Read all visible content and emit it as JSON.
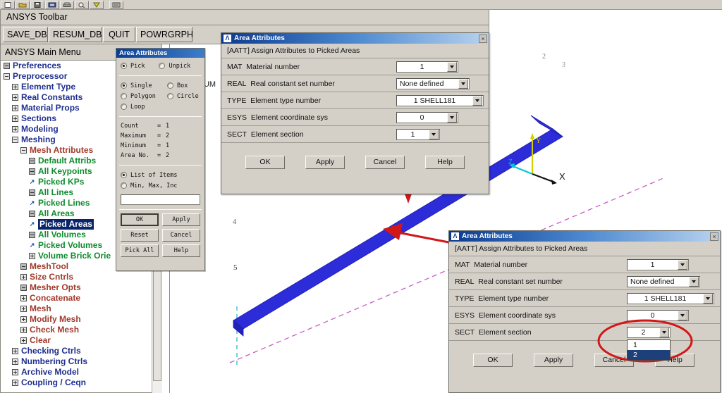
{
  "icon_toolbar": {
    "icons": [
      "new-file-icon",
      "open-folder-icon",
      "save-disk-icon",
      "read-input-icon",
      "print-icon",
      "print-preview-icon",
      "report-icon",
      "ansys-help-icon"
    ]
  },
  "toolbar": {
    "label": "ANSYS Toolbar",
    "buttons": [
      "SAVE_DB",
      "RESUM_DB",
      "QUIT",
      "POWRGRPH"
    ]
  },
  "main_menu": {
    "header": "ANSYS Main Menu",
    "items": [
      {
        "label": "Preferences",
        "indent": 0,
        "icon": "box-solid",
        "color": "blue",
        "selected": false
      },
      {
        "label": "Preprocessor",
        "indent": 0,
        "icon": "box-minus",
        "color": "blue",
        "selected": false
      },
      {
        "label": "Element Type",
        "indent": 1,
        "icon": "box-plus",
        "color": "blue",
        "selected": false
      },
      {
        "label": "Real Constants",
        "indent": 1,
        "icon": "box-plus",
        "color": "blue",
        "selected": false
      },
      {
        "label": "Material Props",
        "indent": 1,
        "icon": "box-plus",
        "color": "blue",
        "selected": false
      },
      {
        "label": "Sections",
        "indent": 1,
        "icon": "box-plus",
        "color": "blue",
        "selected": false
      },
      {
        "label": "Modeling",
        "indent": 1,
        "icon": "box-plus",
        "color": "blue",
        "selected": false
      },
      {
        "label": "Meshing",
        "indent": 1,
        "icon": "box-minus",
        "color": "blue",
        "selected": false
      },
      {
        "label": "Mesh Attributes",
        "indent": 2,
        "icon": "box-minus",
        "color": "red",
        "selected": false
      },
      {
        "label": "Default Attribs",
        "indent": 3,
        "icon": "box-solid",
        "color": "green",
        "selected": false
      },
      {
        "label": "All Keypoints",
        "indent": 3,
        "icon": "box-solid",
        "color": "green",
        "selected": false
      },
      {
        "label": "Picked KPs",
        "indent": 3,
        "icon": "arrow",
        "color": "green",
        "selected": false
      },
      {
        "label": "All Lines",
        "indent": 3,
        "icon": "box-solid",
        "color": "green",
        "selected": false
      },
      {
        "label": "Picked Lines",
        "indent": 3,
        "icon": "arrow",
        "color": "green",
        "selected": false
      },
      {
        "label": "All Areas",
        "indent": 3,
        "icon": "box-solid",
        "color": "green",
        "selected": false
      },
      {
        "label": "Picked Areas",
        "indent": 3,
        "icon": "arrow",
        "color": "green",
        "selected": true
      },
      {
        "label": "All Volumes",
        "indent": 3,
        "icon": "box-solid",
        "color": "green",
        "selected": false
      },
      {
        "label": "Picked Volumes",
        "indent": 3,
        "icon": "arrow",
        "color": "green",
        "selected": false
      },
      {
        "label": "Volume Brick Orie",
        "indent": 3,
        "icon": "box-plus",
        "color": "green",
        "selected": false
      },
      {
        "label": "MeshTool",
        "indent": 2,
        "icon": "box-solid",
        "color": "red",
        "selected": false
      },
      {
        "label": "Size Cntrls",
        "indent": 2,
        "icon": "box-plus",
        "color": "red",
        "selected": false
      },
      {
        "label": "Mesher Opts",
        "indent": 2,
        "icon": "box-solid",
        "color": "red",
        "selected": false
      },
      {
        "label": "Concatenate",
        "indent": 2,
        "icon": "box-plus",
        "color": "red",
        "selected": false
      },
      {
        "label": "Mesh",
        "indent": 2,
        "icon": "box-plus",
        "color": "red",
        "selected": false
      },
      {
        "label": "Modify Mesh",
        "indent": 2,
        "icon": "box-plus",
        "color": "red",
        "selected": false
      },
      {
        "label": "Check Mesh",
        "indent": 2,
        "icon": "box-plus",
        "color": "red",
        "selected": false
      },
      {
        "label": "Clear",
        "indent": 2,
        "icon": "box-plus",
        "color": "red",
        "selected": false
      },
      {
        "label": "Checking Ctrls",
        "indent": 1,
        "icon": "box-plus",
        "color": "blue",
        "selected": false
      },
      {
        "label": "Numbering Ctrls",
        "indent": 1,
        "icon": "box-plus",
        "color": "blue",
        "selected": false
      },
      {
        "label": "Archive Model",
        "indent": 1,
        "icon": "box-plus",
        "color": "blue",
        "selected": false
      },
      {
        "label": "Coupling / Ceqn",
        "indent": 1,
        "icon": "box-plus",
        "color": "blue",
        "selected": false
      }
    ]
  },
  "pick_dialog": {
    "title": "Area Attributes",
    "mode_options": [
      {
        "label": "Pick",
        "selected": true
      },
      {
        "label": "Unpick",
        "selected": false
      }
    ],
    "shape_options": [
      {
        "label": "Single",
        "selected": true
      },
      {
        "label": "Box",
        "selected": false
      },
      {
        "label": "Polygon",
        "selected": false
      },
      {
        "label": "Circle",
        "selected": false
      },
      {
        "label": "Loop",
        "selected": false
      }
    ],
    "counters": [
      {
        "key": "Count",
        "eq": "=",
        "value": "1"
      },
      {
        "key": "Maximum",
        "eq": "=",
        "value": "2"
      },
      {
        "key": "Minimum",
        "eq": "=",
        "value": "1"
      },
      {
        "key": "Area No.",
        "eq": "=",
        "value": "2"
      }
    ],
    "list_options": [
      {
        "label": "List of Items",
        "selected": true
      },
      {
        "label": "Min, Max, Inc",
        "selected": false
      }
    ],
    "input_value": "",
    "buttons": [
      "OK",
      "Apply",
      "Reset",
      "Cancel",
      "Pick All",
      "Help"
    ]
  },
  "area_attributes_top": {
    "title": "Area Attributes",
    "close_label": "×",
    "subheader": "[AATT]  Assign Attributes to Picked Areas",
    "rows": [
      {
        "code": "MAT",
        "label": "Material number",
        "value": "1"
      },
      {
        "code": "REAL",
        "label": "Real constant set number",
        "value": "None defined"
      },
      {
        "code": "TYPE",
        "label": "Element type number",
        "value": "1     SHELL181"
      },
      {
        "code": "ESYS",
        "label": "Element coordinate sys",
        "value": "0"
      },
      {
        "code": "SECT",
        "label": "Element section",
        "value": "1"
      }
    ],
    "buttons": [
      "OK",
      "Apply",
      "Cancel",
      "Help"
    ]
  },
  "area_attributes_bottom": {
    "title": "Area Attributes",
    "close_label": "×",
    "subheader": "[AATT]  Assign Attributes to Picked Areas",
    "rows": [
      {
        "code": "MAT",
        "label": "Material number",
        "value": "1"
      },
      {
        "code": "REAL",
        "label": "Real constant set number",
        "value": "None defined"
      },
      {
        "code": "TYPE",
        "label": "Element type number",
        "value": "1     SHELL181"
      },
      {
        "code": "ESYS",
        "label": "Element coordinate sys",
        "value": "0"
      },
      {
        "code": "SECT",
        "label": "Element section",
        "value": "2"
      }
    ],
    "sect_dropdown_options": [
      {
        "label": "1",
        "selected": false
      },
      {
        "label": "2",
        "selected": true
      }
    ],
    "buttons": [
      "OK",
      "Apply",
      "Cancel",
      "Help"
    ]
  },
  "graphics": {
    "status_text": "NUM",
    "axis_labels": {
      "x": "X",
      "y": "Y",
      "z": "Z"
    },
    "keypoint_labels": [
      "2",
      "3",
      "4",
      "5"
    ],
    "model_color": "#2222dd",
    "guide_line_color": "#c060c0",
    "annotation_color": "#cc0000"
  }
}
